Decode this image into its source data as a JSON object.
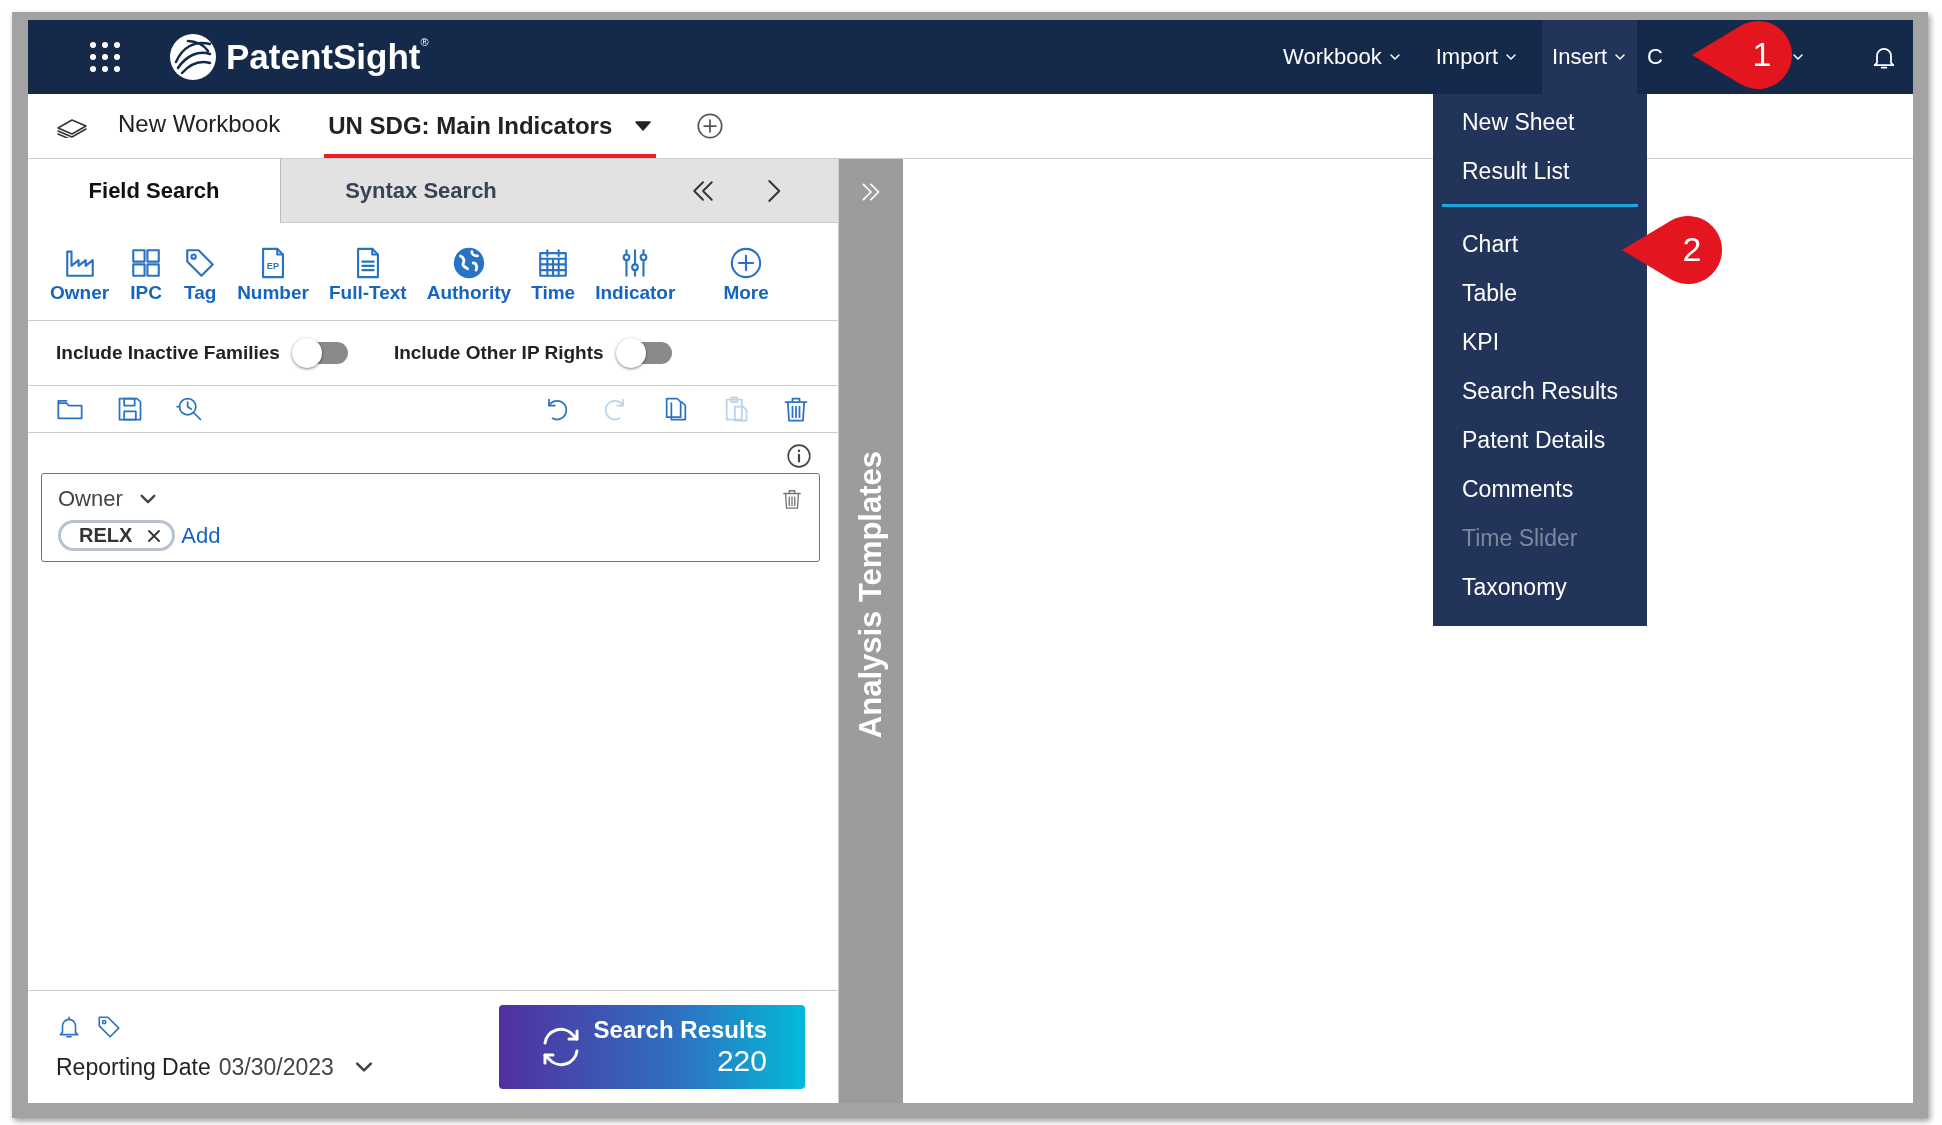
{
  "top_bar": {
    "brand": "PatentSight",
    "brand_mark": "®",
    "nav": [
      {
        "label": "Workbook",
        "selected": false
      },
      {
        "label": "Import",
        "selected": false
      },
      {
        "label": "Insert",
        "selected": true
      },
      {
        "label": "C",
        "selected": false
      }
    ]
  },
  "workbook_tabs": [
    {
      "label": "New Workbook",
      "selected": false
    },
    {
      "label": "UN SDG: Main Indicators",
      "selected": true
    }
  ],
  "insert_menu": {
    "sections": [
      {
        "items": [
          {
            "label": "New Sheet",
            "disabled": false
          },
          {
            "label": "Result List",
            "disabled": false
          }
        ]
      },
      {
        "items": [
          {
            "label": "Chart",
            "disabled": false
          },
          {
            "label": "Table",
            "disabled": false
          },
          {
            "label": "KPI",
            "disabled": false
          },
          {
            "label": "Search Results",
            "disabled": false
          },
          {
            "label": "Patent Details",
            "disabled": false
          },
          {
            "label": "Comments",
            "disabled": false
          },
          {
            "label": "Time Slider",
            "disabled": true
          },
          {
            "label": "Taxonomy",
            "disabled": false
          }
        ]
      }
    ]
  },
  "search_panel": {
    "tabs": [
      {
        "label": "Field Search",
        "selected": true
      },
      {
        "label": "Syntax Search",
        "selected": false
      }
    ],
    "fields": [
      {
        "label": "Owner"
      },
      {
        "label": "IPC"
      },
      {
        "label": "Tag"
      },
      {
        "label": "Number",
        "icon_text": "EP"
      },
      {
        "label": "Full-Text"
      },
      {
        "label": "Authority"
      },
      {
        "label": "Time"
      },
      {
        "label": "Indicator"
      },
      {
        "label": "More"
      }
    ],
    "toggles": [
      {
        "label": "Include Inactive Families",
        "on": false
      },
      {
        "label": "Include Other IP Rights",
        "on": false
      }
    ],
    "tools": [
      {
        "disabled": false
      },
      {
        "disabled": false
      },
      {
        "disabled": false
      },
      {
        "disabled": false
      },
      {
        "disabled": true
      },
      {
        "disabled": false
      },
      {
        "disabled": true
      },
      {
        "disabled": false
      }
    ],
    "filter": {
      "field": "Owner",
      "chips": [
        "RELX"
      ],
      "add_label": "Add"
    },
    "reporting_date": {
      "label": "Reporting Date",
      "value": "03/30/2023"
    },
    "search_button": {
      "label": "Search Results",
      "count": "220"
    }
  },
  "templates_strip": {
    "label": "Analysis Templates"
  },
  "callouts": [
    {
      "number": "1"
    },
    {
      "number": "2"
    }
  ]
}
